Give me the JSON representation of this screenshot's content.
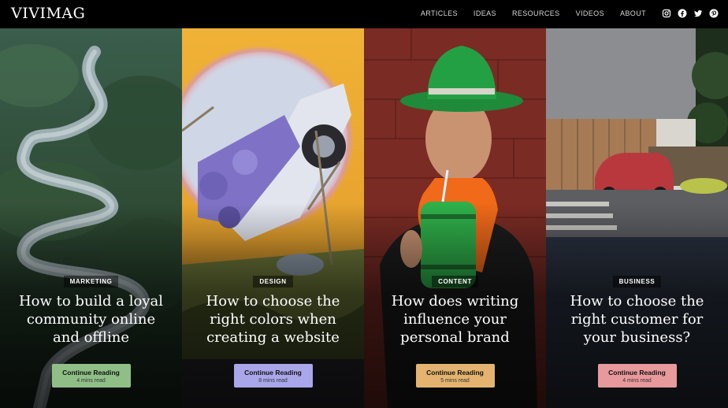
{
  "header": {
    "logo": "VIVIMAG",
    "nav": [
      "ARTICLES",
      "IDEAS",
      "RESOURCES",
      "VIDEOS",
      "ABOUT"
    ],
    "social_icons": [
      "instagram-icon",
      "facebook-icon",
      "twitter-icon",
      "pinterest-icon"
    ]
  },
  "articles": [
    {
      "category": "MARKETING",
      "title": "How to build a loyal community online and offline",
      "button_label": "Continue Reading",
      "read_time": "4 mins read",
      "button_color": "#8fbf86",
      "image": "aerial river valley"
    },
    {
      "category": "DESIGN",
      "title": "How to choose the right colors when creating a website",
      "button_label": "Continue Reading",
      "read_time": "8 mins read",
      "button_color": "#a9a6ea",
      "image": "surreal car with flowers"
    },
    {
      "category": "CONTENT",
      "title": "How does writing influence your personal brand",
      "button_label": "Continue Reading",
      "read_time": "5 mins read",
      "button_color": "#e3b36f",
      "image": "man in green hat with mug"
    },
    {
      "category": "BUSINESS",
      "title": "How to choose the right customer for your business?",
      "button_label": "Continue Reading",
      "read_time": "4 mins read",
      "button_color": "#e8999c",
      "image": "red car in modern house driveway"
    }
  ]
}
